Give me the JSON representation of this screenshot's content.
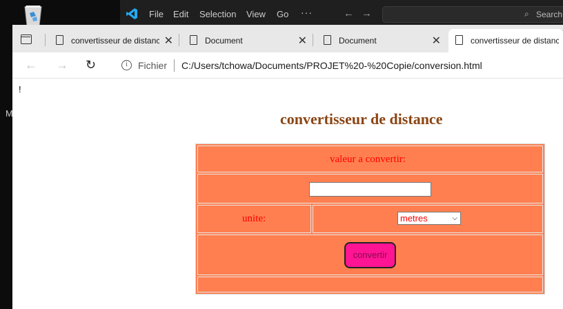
{
  "desktop": {
    "letter": "M"
  },
  "vscode": {
    "menu": [
      "File",
      "Edit",
      "Selection",
      "View",
      "Go"
    ],
    "more": "···",
    "search_placeholder": "Search"
  },
  "browser": {
    "tabs": [
      {
        "title": "convertisseur de distanc",
        "active": false
      },
      {
        "title": "Document",
        "active": false
      },
      {
        "title": "Document",
        "active": false
      },
      {
        "title": "convertisseur de distanc",
        "active": true
      }
    ],
    "address": {
      "scheme_label": "Fichier",
      "url": "C:/Users/tchowa/Documents/PROJET%20-%20Copie/conversion.html"
    }
  },
  "page": {
    "bang": "!",
    "title": "convertisseur de distance",
    "value_label": "valeur a convertir:",
    "value_input": "",
    "unit_label": "unite:",
    "unit_selected": "metres",
    "convert_label": "convertir"
  },
  "colors": {
    "table_bg": "#ff7f50",
    "title": "#8b4513",
    "label": "#ff0000",
    "button": "#ff1493"
  }
}
